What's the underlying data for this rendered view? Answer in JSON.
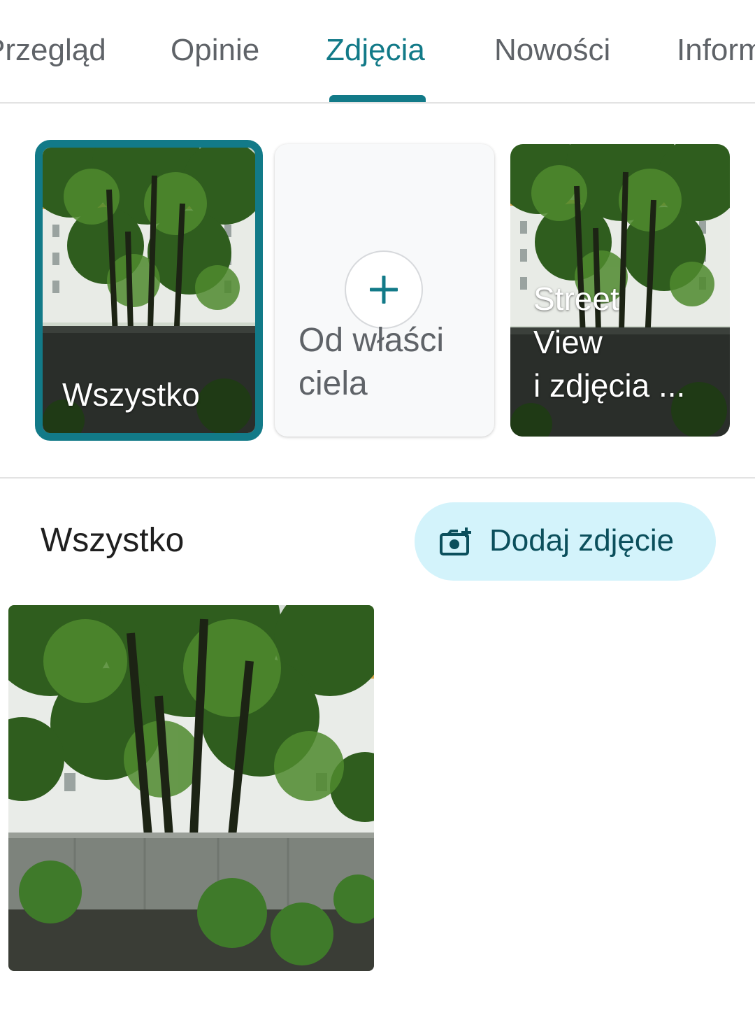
{
  "tabs": [
    {
      "label": "Przegląd",
      "active": false
    },
    {
      "label": "Opinie",
      "active": false
    },
    {
      "label": "Zdjęcia",
      "active": true
    },
    {
      "label": "Nowości",
      "active": false
    },
    {
      "label": "Informacje",
      "active": false
    }
  ],
  "albums": {
    "all_label": "Wszystko",
    "owner_label": "Od właści\nciela",
    "street_label": "Street\nView\ni zdjęcia ..."
  },
  "section": {
    "title": "Wszystko",
    "add_photo_label": "Dodaj zdjęcie",
    "add_photo_icon": "add-photo-camera-icon"
  },
  "colors": {
    "accent": "#127a88",
    "button_bg": "#d3f3fb",
    "button_text": "#0b4f5c",
    "tab_inactive": "#5f6368"
  },
  "photos": [
    {
      "alt": "street-view-photo"
    }
  ]
}
